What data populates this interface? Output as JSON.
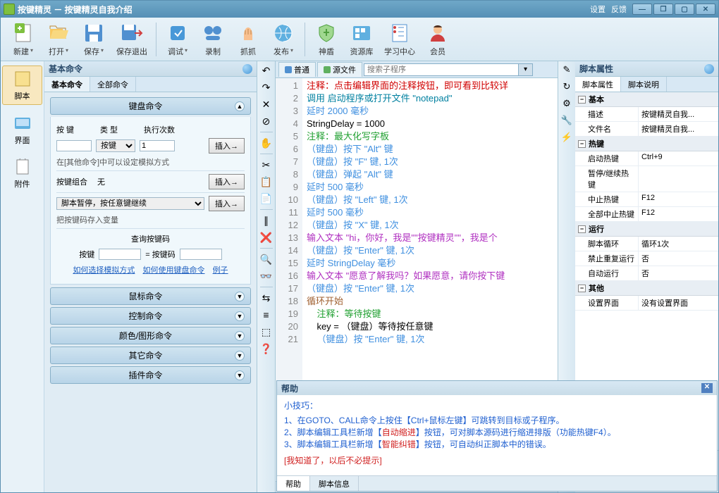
{
  "title": "按键精灵 － 按键精灵自我介绍",
  "titlebar_links": [
    "设置",
    "反馈"
  ],
  "toolbar": [
    {
      "label": "新建",
      "dd": true
    },
    {
      "label": "打开",
      "dd": true
    },
    {
      "label": "保存",
      "dd": true
    },
    {
      "label": "保存退出"
    },
    {
      "sep": true
    },
    {
      "label": "调试",
      "dd": true
    },
    {
      "label": "录制"
    },
    {
      "label": "抓抓"
    },
    {
      "label": "发布",
      "dd": true
    },
    {
      "sep": true
    },
    {
      "label": "神盾"
    },
    {
      "label": "资源库"
    },
    {
      "label": "学习中心"
    },
    {
      "label": "会员"
    }
  ],
  "left_items": [
    {
      "label": "脚本",
      "sel": true
    },
    {
      "label": "界面"
    },
    {
      "label": "附件"
    }
  ],
  "cmd_panel": {
    "title": "基本命令",
    "tabs": [
      "基本命令",
      "全部命令"
    ],
    "keyboard_hdr": "键盘命令",
    "row1": {
      "l1": "按 键",
      "l2": "类 型",
      "l3": "执行次数"
    },
    "row1v": {
      "type_opt": "按键",
      "count": "1"
    },
    "insert": "插入→",
    "note1": "在[其他命令]中可以设定模拟方式",
    "combo_label": "按键组合",
    "combo_val": "无",
    "pause_opt": "脚本暂停，按任意键继续",
    "note2": "把按键码存入变量",
    "lookup_title": "查询按键码",
    "lookup_l": "按键",
    "lookup_eq": "= 按键码",
    "links": [
      "如何选择模拟方式",
      "如何使用键盘命令",
      "例子"
    ],
    "groups": [
      "鼠标命令",
      "控制命令",
      "颜色/图形命令",
      "其它命令",
      "插件命令"
    ]
  },
  "ed_tabs": [
    "普通",
    "源文件"
  ],
  "search_placeholder": "搜索子程序",
  "code_lines": [
    {
      "n": 1,
      "cls": "c-comment",
      "t": "注释：点击编辑界面的注释按钮，即可看到比较详"
    },
    {
      "n": 2,
      "cls": "c-call",
      "t": "调用 启动程序或打开文件 \"notepad\""
    },
    {
      "n": 3,
      "cls": "c-blue",
      "t": "延时 2000 毫秒"
    },
    {
      "n": 4,
      "cls": "",
      "t": "StringDelay = 1000"
    },
    {
      "n": 5,
      "cls": "c-green",
      "t": "注释：最大化写字板"
    },
    {
      "n": 6,
      "cls": "c-blue",
      "t": "（键盘）按下 \"Alt\" 键"
    },
    {
      "n": 7,
      "cls": "c-blue",
      "t": "（键盘）按 \"F\" 键, 1次"
    },
    {
      "n": 8,
      "cls": "c-blue",
      "t": "（键盘）弹起 \"Alt\" 键"
    },
    {
      "n": 9,
      "cls": "c-blue",
      "t": "延时 500 毫秒"
    },
    {
      "n": 10,
      "cls": "c-blue",
      "t": "（键盘）按 \"Left\" 键, 1次"
    },
    {
      "n": 11,
      "cls": "c-blue",
      "t": "延时 500 毫秒"
    },
    {
      "n": 12,
      "cls": "c-blue",
      "t": "（键盘）按 \"X\" 键, 1次"
    },
    {
      "n": 13,
      "cls": "c-purple",
      "t": "输入文本 \"hi，你好，我是\"\"按键精灵\"\"，我是个"
    },
    {
      "n": 14,
      "cls": "c-blue",
      "t": "（键盘）按 \"Enter\" 键, 1次"
    },
    {
      "n": 15,
      "cls": "c-blue",
      "t": "延时 StringDelay 毫秒"
    },
    {
      "n": 16,
      "cls": "c-purple",
      "t": "输入文本 \"愿意了解我吗？如果愿意，请你按下键"
    },
    {
      "n": 17,
      "cls": "c-blue",
      "t": "（键盘）按 \"Enter\" 键, 1次"
    },
    {
      "n": 18,
      "cls": "c-brown",
      "t": "循环开始"
    },
    {
      "n": 19,
      "cls": "c-green",
      "t": "    注释：等待按键"
    },
    {
      "n": 20,
      "cls": "",
      "t": "    key = （键盘）等待按任意键"
    },
    {
      "n": 21,
      "cls": "c-blue",
      "t": "    （键盘）按 \"Enter\" 键, 1次"
    }
  ],
  "prop": {
    "title": "脚本属性",
    "tabs": [
      "脚本属性",
      "脚本说明"
    ],
    "cats": [
      {
        "name": "基本",
        "rows": [
          {
            "k": "描述",
            "v": "按键精灵自我..."
          },
          {
            "k": "文件名",
            "v": "按键精灵自我..."
          }
        ]
      },
      {
        "name": "热键",
        "rows": [
          {
            "k": "启动热键",
            "v": "Ctrl+9"
          },
          {
            "k": "暂停/继续热键",
            "v": ""
          },
          {
            "k": "中止热键",
            "v": "F12"
          },
          {
            "k": "全部中止热键",
            "v": "F12"
          }
        ]
      },
      {
        "name": "运行",
        "rows": [
          {
            "k": "脚本循环",
            "v": "循环1次"
          },
          {
            "k": "禁止重复运行",
            "v": "否"
          },
          {
            "k": "自动运行",
            "v": "否"
          }
        ]
      },
      {
        "name": "其他",
        "rows": [
          {
            "k": "设置界面",
            "v": "没有设置界面"
          }
        ]
      }
    ]
  },
  "help": {
    "title": "帮助",
    "tip_head": "小技巧：",
    "lines": [
      {
        "pre": "1、在GOTO、CALL命令上按住【Ctrl+鼠标左键】可跳转到目标或子程序。"
      },
      {
        "pre": "2、脚本编辑工具栏新增【",
        "red": "自动缩进",
        "post": "】按钮，可对脚本源码进行缩进排版（功能热键F4）。"
      },
      {
        "pre": "3、脚本编辑工具栏新增【",
        "red": "智能纠错",
        "post": "】按钮，可自动纠正脚本中的错误。"
      }
    ],
    "dismiss": "[我知道了，以后不必提示]",
    "tabs": [
      "帮助",
      "脚本信息"
    ]
  }
}
